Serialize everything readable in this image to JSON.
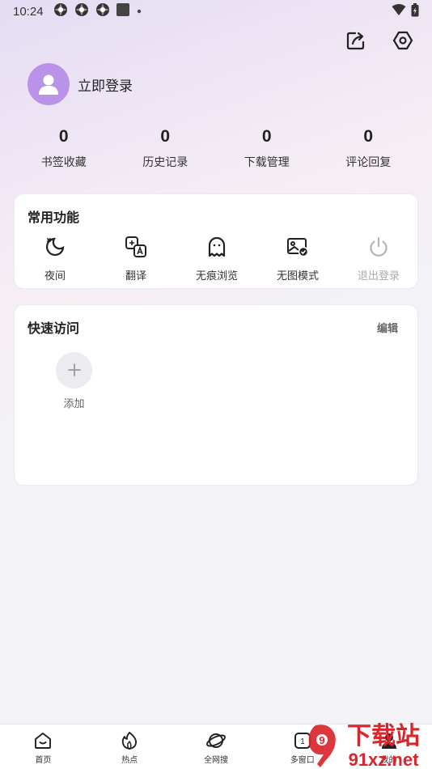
{
  "status_bar": {
    "time": "10:24"
  },
  "profile": {
    "login_label": "立即登录"
  },
  "stats": [
    {
      "value": "0",
      "label": "书签收藏"
    },
    {
      "value": "0",
      "label": "历史记录"
    },
    {
      "value": "0",
      "label": "下载管理"
    },
    {
      "value": "0",
      "label": "评论回复"
    }
  ],
  "features": {
    "title": "常用功能",
    "items": [
      {
        "label": "夜间",
        "icon": "moon-icon"
      },
      {
        "label": "翻译",
        "icon": "translate-icon"
      },
      {
        "label": "无痕浏览",
        "icon": "ghost-icon"
      },
      {
        "label": "无图模式",
        "icon": "no-image-icon"
      },
      {
        "label": "退出登录",
        "icon": "power-icon"
      }
    ]
  },
  "quick_access": {
    "title": "快速访问",
    "edit_label": "编辑",
    "add_label": "添加"
  },
  "bottom_nav": [
    {
      "label": "首页",
      "icon": "home-icon"
    },
    {
      "label": "热点",
      "icon": "flame-icon"
    },
    {
      "label": "全网搜",
      "icon": "planet-icon"
    },
    {
      "label": "多窗口",
      "icon": "windows-icon",
      "badge": "1"
    },
    {
      "label": "我的",
      "icon": "user-icon"
    }
  ],
  "watermark": {
    "text_cn": "下载站",
    "text_en": "91xz.net",
    "logo_text": "9"
  },
  "colors": {
    "avatar": "#b993e8",
    "watermark_red": "#d9262c"
  }
}
